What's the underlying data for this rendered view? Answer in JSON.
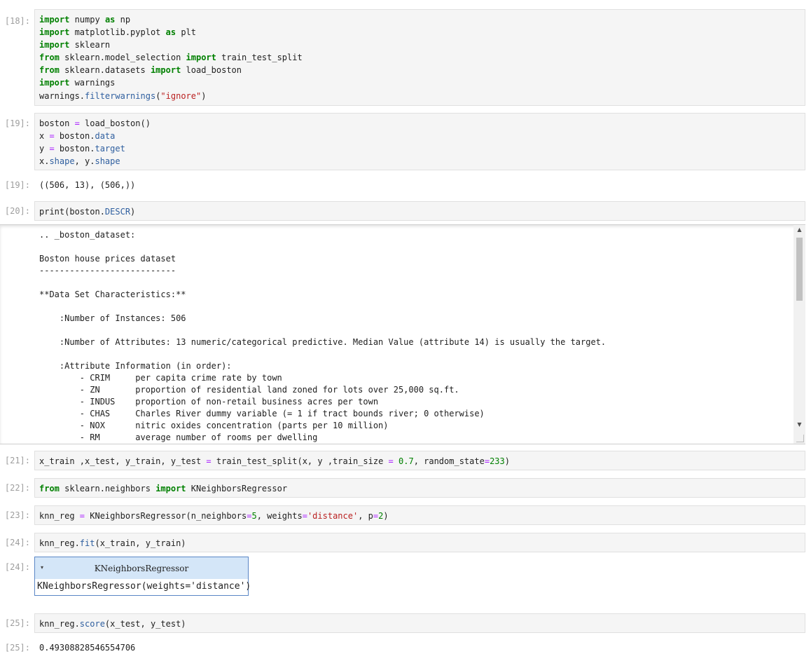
{
  "cells": {
    "c18": {
      "prompt_in": "[18]:",
      "lines": [
        [
          {
            "t": "import",
            "c": "kw"
          },
          {
            "t": " numpy "
          },
          {
            "t": "as",
            "c": "kw"
          },
          {
            "t": " np"
          }
        ],
        [
          {
            "t": "import",
            "c": "kw"
          },
          {
            "t": " matplotlib.pyplot "
          },
          {
            "t": "as",
            "c": "kw"
          },
          {
            "t": " plt"
          }
        ],
        [
          {
            "t": "import",
            "c": "kw"
          },
          {
            "t": " sklearn"
          }
        ],
        [
          {
            "t": "from",
            "c": "kw"
          },
          {
            "t": " sklearn.model_selection "
          },
          {
            "t": "import",
            "c": "kw"
          },
          {
            "t": " train_test_split"
          }
        ],
        [
          {
            "t": "from",
            "c": "kw"
          },
          {
            "t": " sklearn.datasets "
          },
          {
            "t": "import",
            "c": "kw"
          },
          {
            "t": " load_boston"
          }
        ],
        [
          {
            "t": "import",
            "c": "kw"
          },
          {
            "t": " warnings"
          }
        ],
        [
          {
            "t": "warnings."
          },
          {
            "t": "filterwarnings",
            "c": "attr"
          },
          {
            "t": "("
          },
          {
            "t": "\"ignore\"",
            "c": "str"
          },
          {
            "t": ")"
          }
        ]
      ]
    },
    "c19": {
      "prompt_in": "[19]:",
      "prompt_out": "[19]:",
      "lines": [
        [
          {
            "t": "boston "
          },
          {
            "t": "=",
            "c": "op"
          },
          {
            "t": " load_boston()"
          }
        ],
        [
          {
            "t": "x "
          },
          {
            "t": "=",
            "c": "op"
          },
          {
            "t": " boston."
          },
          {
            "t": "data",
            "c": "attr"
          }
        ],
        [
          {
            "t": "y "
          },
          {
            "t": "=",
            "c": "op"
          },
          {
            "t": " boston."
          },
          {
            "t": "target",
            "c": "attr"
          }
        ],
        [
          {
            "t": "x."
          },
          {
            "t": "shape",
            "c": "attr"
          },
          {
            "t": ", y."
          },
          {
            "t": "shape",
            "c": "attr"
          }
        ]
      ],
      "output": "((506, 13), (506,))"
    },
    "c20": {
      "prompt_in": "[20]:",
      "lines": [
        [
          {
            "t": "print(boston."
          },
          {
            "t": "DESCR",
            "c": "attr"
          },
          {
            "t": ")"
          }
        ]
      ],
      "output_lines": [
        ".. _boston_dataset:",
        "",
        "Boston house prices dataset",
        "---------------------------",
        "",
        "**Data Set Characteristics:**  ",
        "",
        "    :Number of Instances: 506 ",
        "",
        "    :Number of Attributes: 13 numeric/categorical predictive. Median Value (attribute 14) is usually the target.",
        "",
        "    :Attribute Information (in order):",
        "        - CRIM     per capita crime rate by town",
        "        - ZN       proportion of residential land zoned for lots over 25,000 sq.ft.",
        "        - INDUS    proportion of non-retail business acres per town",
        "        - CHAS     Charles River dummy variable (= 1 if tract bounds river; 0 otherwise)",
        "        - NOX      nitric oxides concentration (parts per 10 million)",
        "        - RM       average number of rooms per dwelling"
      ]
    },
    "c21": {
      "prompt_in": "[21]:",
      "lines": [
        [
          {
            "t": "x_train ,x_test, y_train, y_test "
          },
          {
            "t": "=",
            "c": "op"
          },
          {
            "t": " train_test_split(x, y ,train_size "
          },
          {
            "t": "=",
            "c": "op"
          },
          {
            "t": " "
          },
          {
            "t": "0.7",
            "c": "num"
          },
          {
            "t": ", random_state"
          },
          {
            "t": "=",
            "c": "op"
          },
          {
            "t": "233",
            "c": "num"
          },
          {
            "t": ")"
          }
        ]
      ]
    },
    "c22": {
      "prompt_in": "[22]:",
      "lines": [
        [
          {
            "t": "from",
            "c": "kw"
          },
          {
            "t": " sklearn.neighbors "
          },
          {
            "t": "import",
            "c": "kw"
          },
          {
            "t": " KNeighborsRegressor"
          }
        ]
      ]
    },
    "c23": {
      "prompt_in": "[23]:",
      "lines": [
        [
          {
            "t": "knn_reg "
          },
          {
            "t": "=",
            "c": "op"
          },
          {
            "t": " KNeighborsRegressor(n_neighbors"
          },
          {
            "t": "=",
            "c": "op"
          },
          {
            "t": "5",
            "c": "num"
          },
          {
            "t": ", weights"
          },
          {
            "t": "=",
            "c": "op"
          },
          {
            "t": "'distance'",
            "c": "str"
          },
          {
            "t": ", p"
          },
          {
            "t": "=",
            "c": "op"
          },
          {
            "t": "2",
            "c": "num"
          },
          {
            "t": ")"
          }
        ]
      ]
    },
    "c24": {
      "prompt_in": "[24]:",
      "prompt_out": "[24]:",
      "lines": [
        [
          {
            "t": "knn_reg."
          },
          {
            "t": "fit",
            "c": "attr"
          },
          {
            "t": "(x_train, y_train)"
          }
        ]
      ],
      "widget_title": "KNeighborsRegressor",
      "widget_toggle": "▾",
      "widget_body": "KNeighborsRegressor(weights='distance')"
    },
    "c25": {
      "prompt_in": "[25]:",
      "prompt_out": "[25]:",
      "lines": [
        [
          {
            "t": "knn_reg."
          },
          {
            "t": "score",
            "c": "attr"
          },
          {
            "t": "(x_test, y_test)"
          }
        ]
      ],
      "output": "0.49308828546554706"
    }
  },
  "scrollbar": {
    "up_icon": "▲",
    "down_icon": "▼"
  }
}
